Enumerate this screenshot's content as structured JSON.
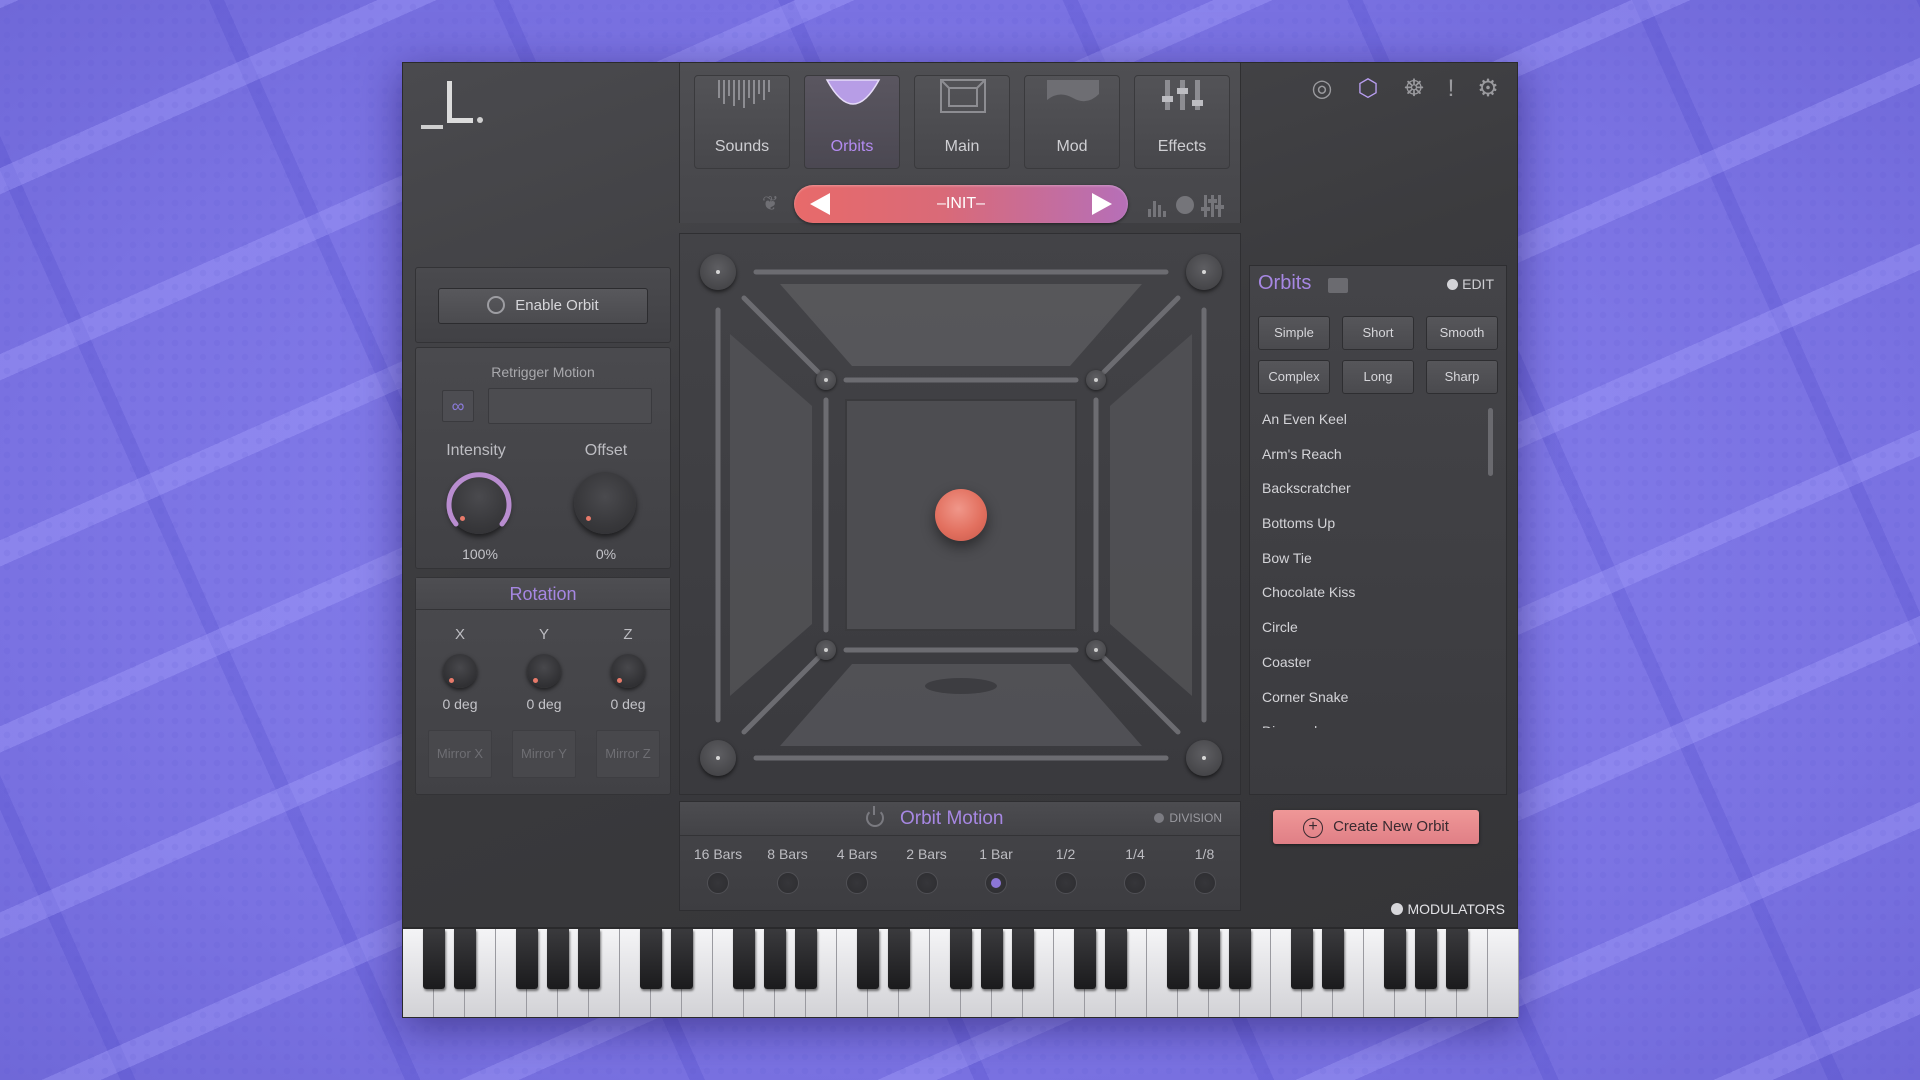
{
  "tabs": [
    {
      "label": "Sounds",
      "icon": "waveform-icon",
      "active": false
    },
    {
      "label": "Orbits",
      "icon": "orbit-bowl-icon",
      "active": true
    },
    {
      "label": "Main",
      "icon": "main-frame-icon",
      "active": false
    },
    {
      "label": "Mod",
      "icon": "mod-wave-icon",
      "active": false
    },
    {
      "label": "Effects",
      "icon": "sliders-icon",
      "active": false
    }
  ],
  "preset": {
    "name": "–INIT–"
  },
  "top_icons": [
    "spiral-icon",
    "cube-icon",
    "globe-icon",
    "exclamation-icon",
    "gear-icon"
  ],
  "left": {
    "enable_orbit": "Enable Orbit",
    "retrigger_label": "Retrigger Motion",
    "intensity": {
      "label": "Intensity",
      "value": "100%"
    },
    "offset": {
      "label": "Offset",
      "value": "0%"
    }
  },
  "rotation": {
    "title": "Rotation",
    "axes": [
      {
        "label": "X",
        "value": "0 deg"
      },
      {
        "label": "Y",
        "value": "0 deg"
      },
      {
        "label": "Z",
        "value": "0 deg"
      }
    ],
    "mirror": [
      "Mirror X",
      "Mirror Y",
      "Mirror Z"
    ]
  },
  "motion": {
    "title": "Orbit Motion",
    "division_label": "DIVISION",
    "divisions": [
      "16 Bars",
      "8 Bars",
      "4 Bars",
      "2 Bars",
      "1 Bar",
      "1/2",
      "1/4",
      "1/8"
    ],
    "selected_index": 4
  },
  "orbits": {
    "title": "Orbits",
    "edit_label": "EDIT",
    "filters": [
      "Simple",
      "Short",
      "Smooth",
      "Complex",
      "Long",
      "Sharp"
    ],
    "items": [
      "An Even Keel",
      "Arm's Reach",
      "Backscratcher",
      "Bottoms Up",
      "Bow Tie",
      "Chocolate Kiss",
      "Circle",
      "Coaster",
      "Corner Snake",
      "Diagonal"
    ],
    "create_label": "Create New Orbit"
  },
  "modulators_label": "MODULATORS",
  "colors": {
    "accent_purple": "#a687e2",
    "ball": "#e2705f",
    "create_button": "#e88a8f"
  }
}
